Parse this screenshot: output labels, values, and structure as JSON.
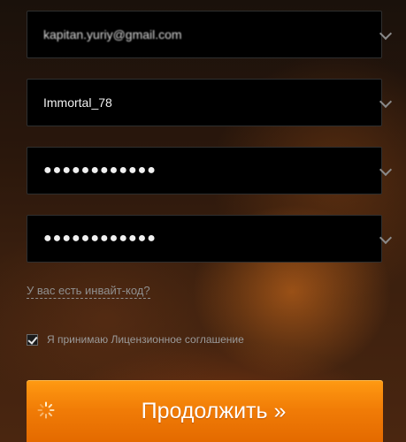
{
  "form": {
    "email": {
      "value": "kapitan.yuriy@gmail.com"
    },
    "login": {
      "value": "Immortal_78"
    },
    "password": {
      "value": "●●●●●●●●●●●●"
    },
    "password_confirm": {
      "value": "●●●●●●●●●●●●"
    },
    "invite_link": "У вас есть инвайт-код?",
    "agree": {
      "checked": true,
      "label": "Я принимаю Лицензионное соглашение"
    },
    "submit": {
      "label": "Продолжить »",
      "icon": "spinner-icon"
    }
  },
  "colors": {
    "button": "#f28107",
    "field_bg": "#000000",
    "link": "#8f8f8f"
  }
}
